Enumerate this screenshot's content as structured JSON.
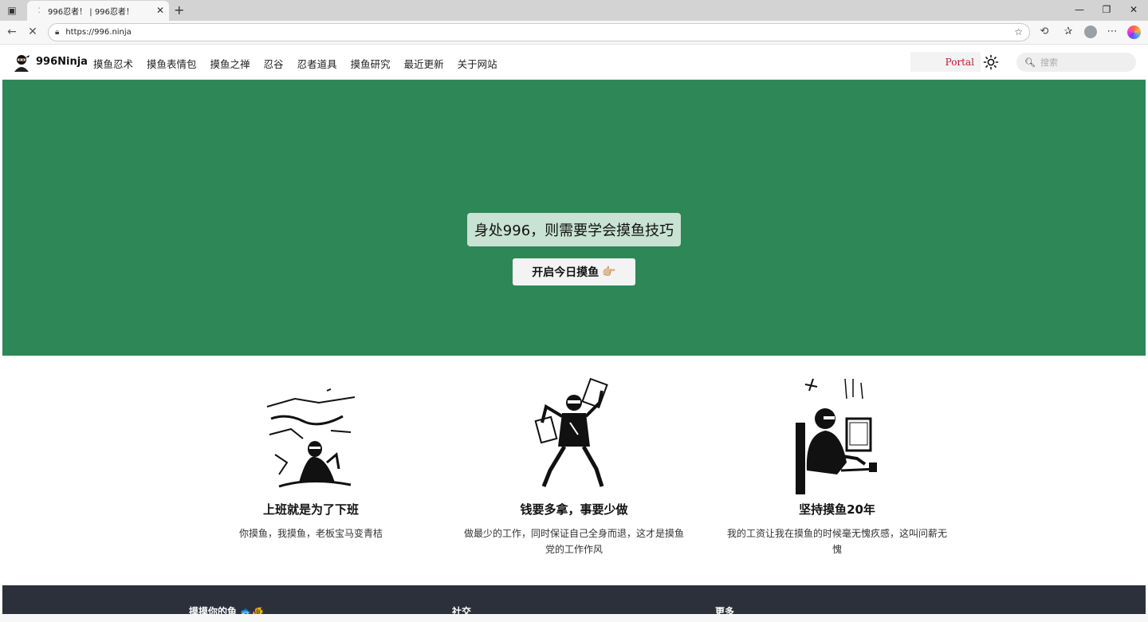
{
  "browser": {
    "tab_title": "996忍者！ | 996忍者！",
    "url": "https://996.ninja"
  },
  "site": {
    "brand": "996Ninja",
    "nav": [
      "摸鱼忍术",
      "摸鱼表情包",
      "摸鱼之禅",
      "忍谷",
      "忍者道具",
      "摸鱼研究",
      "最近更新",
      "关于网站"
    ],
    "portal_label": "Portal",
    "search_placeholder": "搜索"
  },
  "hero": {
    "title": "身处996，则需要学会摸鱼技巧",
    "button_label": "开启今日摸鱼",
    "button_emoji": "👉🏼",
    "background": "#2e8757"
  },
  "features": [
    {
      "title": "上班就是为了下班",
      "desc": "你摸鱼，我摸鱼，老板宝马变青桔"
    },
    {
      "title": "钱要多拿，事要少做",
      "desc": "做最少的工作，同时保证自己全身而退，这才是摸鱼党的工作作风"
    },
    {
      "title": "坚持摸鱼20年",
      "desc": "我的工资让我在摸鱼的时候毫无愧疚感，这叫问薪无愧"
    }
  ],
  "footer": {
    "columns": [
      "摸摸你的鱼 🐟🐠",
      "社交",
      "更多"
    ]
  },
  "colors": {
    "accent_red": "#c4122f",
    "footer_bg": "#2b303b"
  }
}
